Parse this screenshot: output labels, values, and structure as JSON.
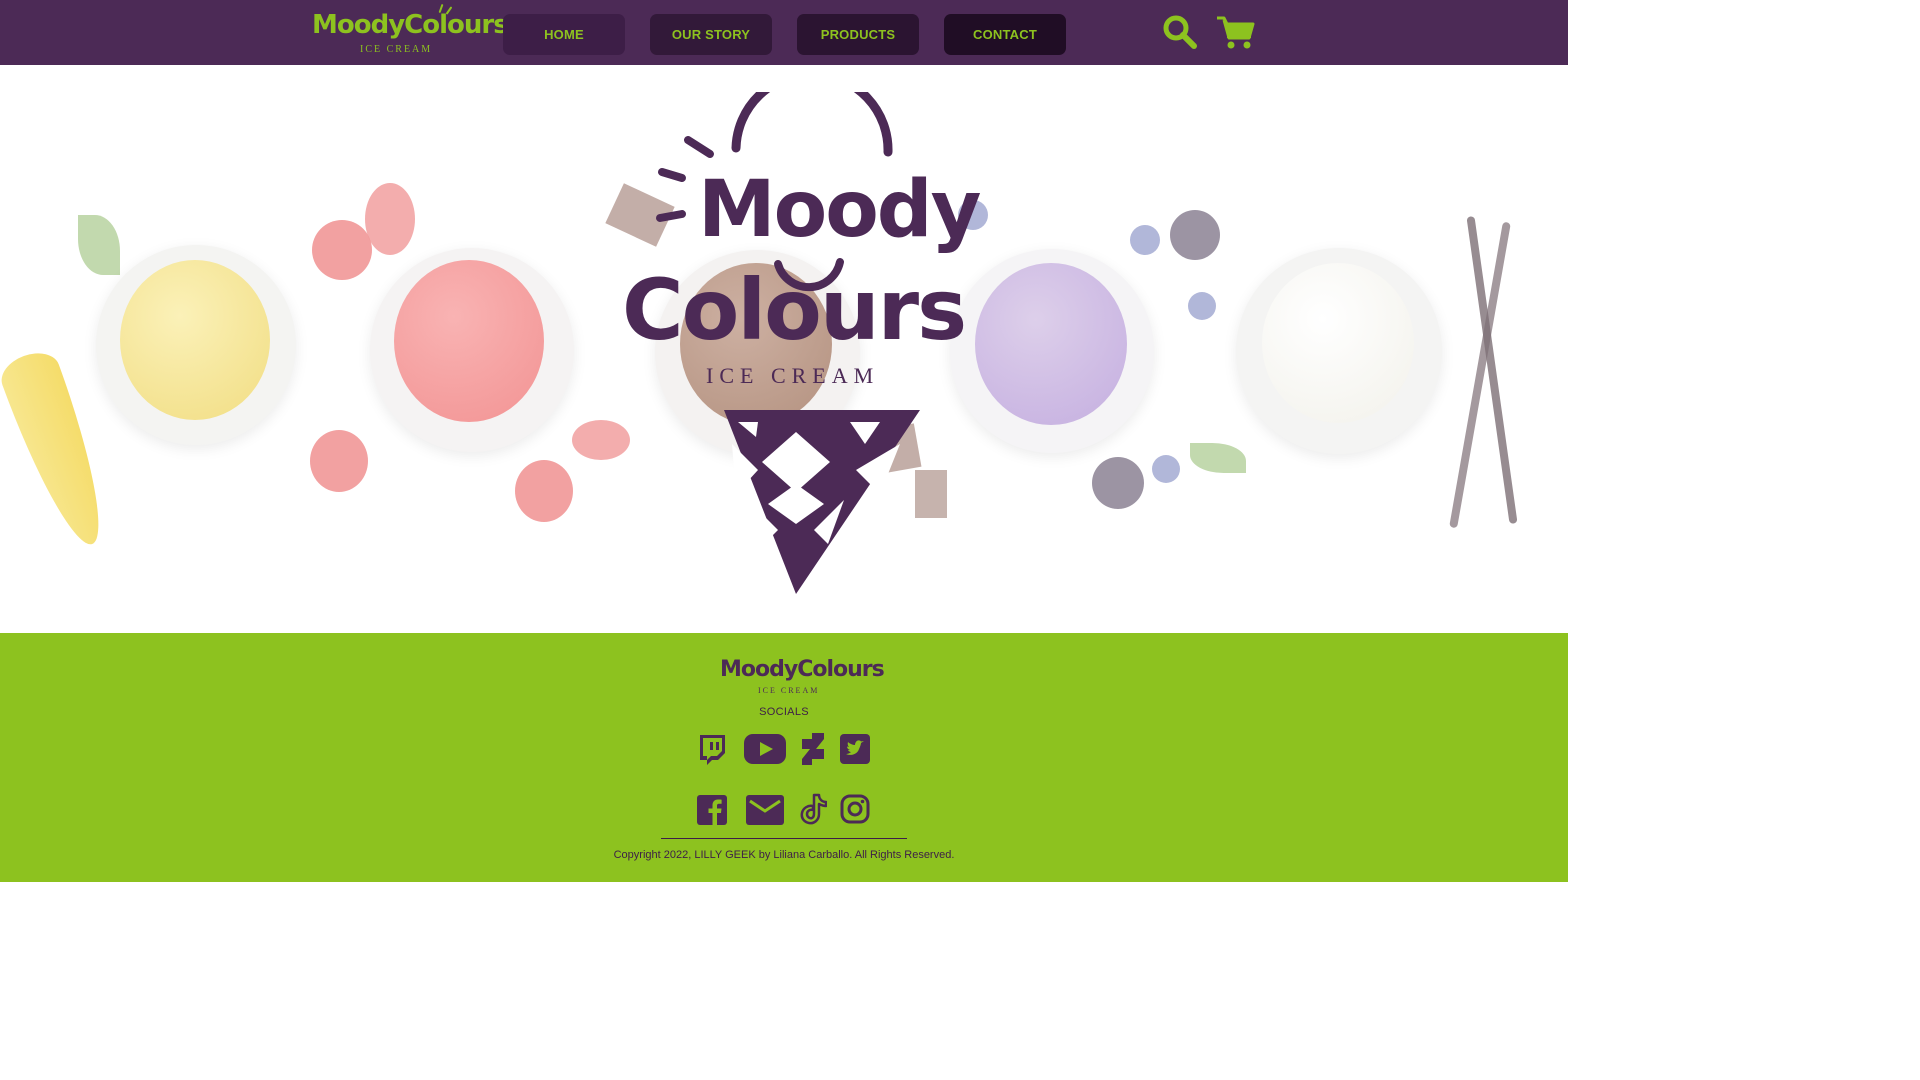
{
  "brand": {
    "name": "MoodyColours",
    "name_line1": "Moody",
    "name_line2": "Colours",
    "tagline": "ICE CREAM"
  },
  "nav": {
    "items": [
      {
        "label": "HOME"
      },
      {
        "label": "OUR STORY"
      },
      {
        "label": "PRODUCTS"
      },
      {
        "label": "CONTACT"
      }
    ]
  },
  "header_icons": [
    "search-icon",
    "cart-icon"
  ],
  "footer": {
    "socials_label": "SOCIALS",
    "social_icons": [
      "twitch-icon",
      "youtube-icon",
      "deviantart-icon",
      "twitter-icon",
      "facebook-icon",
      "email-icon",
      "tiktok-icon",
      "instagram-icon"
    ],
    "copyright": "Copyright 2022, LILLY GEEK by Liliana Carballo. All Rights Reserved."
  },
  "colors": {
    "header_bg": "#4c2a56",
    "accent_green": "#8dc21f",
    "brand_purple": "#4c2a56",
    "footer_bg": "#8dc21f"
  }
}
